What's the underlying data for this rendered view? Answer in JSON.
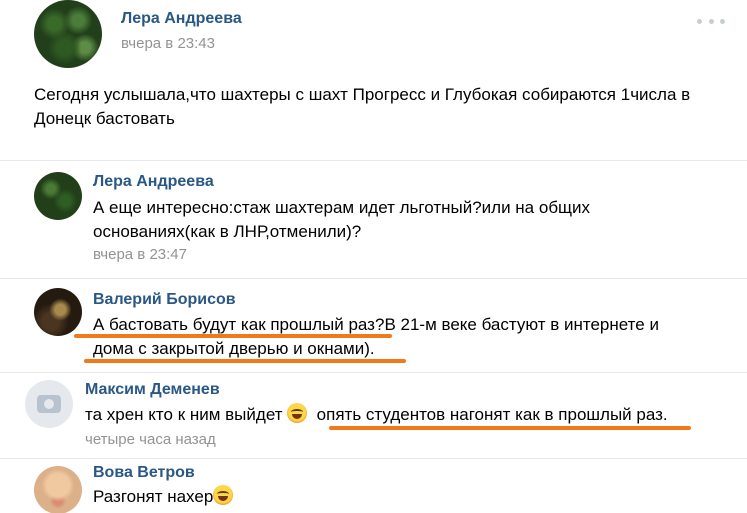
{
  "post": {
    "author": "Лера Андреева",
    "time": "вчера в 23:43",
    "text": "Сегодня услышала,что шахтеры с шахт Прогресс и Глубокая собираются 1числа в Донецк бастовать"
  },
  "comments": [
    {
      "author": "Лера Андреева",
      "text_line1": "А еще интересно:стаж шахтерам идет льготный?или на общих",
      "text_line2": "основаниях(как в ЛНР,отменили)?",
      "time": "вчера в 23:47"
    },
    {
      "author": "Валерий Борисов",
      "text_line1_part1": "А бастовать будут как прошлый раз",
      "text_line1_part2": "?В 21-м веке бастуют в интернете и",
      "text_line2": "дома с закрытой дверью и окнами)."
    },
    {
      "author": "Максим Деменев",
      "text_part1": "та хрен кто к ним выйдет ",
      "text_part2": "опять студентов нагонят как в прошлый раз.",
      "time": "четыре часа назад"
    },
    {
      "author": "Вова Ветров",
      "text": "Разгонят нахер"
    }
  ],
  "colors": {
    "author_link": "#2a5885",
    "time": "#939393",
    "underline_highlight": "#f07a1a"
  },
  "icons": {
    "more": "more-dots-icon",
    "emoji": "laughing-emoji-icon",
    "camera": "camera-placeholder-icon"
  }
}
